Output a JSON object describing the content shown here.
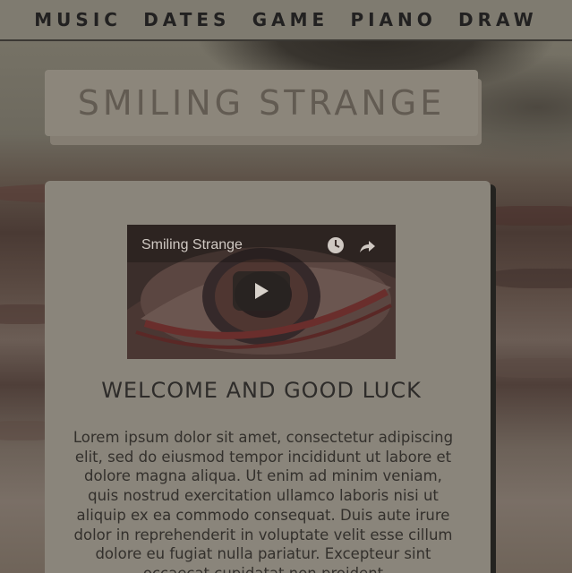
{
  "nav": {
    "items": [
      {
        "label": "MUSIC"
      },
      {
        "label": "DATES"
      },
      {
        "label": "GAME"
      },
      {
        "label": "PIANO"
      },
      {
        "label": "DRAW"
      }
    ]
  },
  "header": {
    "title": "SMILING STRANGE"
  },
  "video": {
    "title": "Smiling Strange",
    "icons": [
      "clock-icon",
      "share-icon",
      "play-icon"
    ]
  },
  "main": {
    "heading": "WELCOME AND GOOD LUCK",
    "body": "Lorem ipsum dolor sit amet, consectetur adipiscing elit, sed do eiusmod tempor incididunt ut labore et dolore magna aliqua. Ut enim ad minim veniam, quis nostrud exercitation ullamco laboris nisi ut aliquip ex ea commodo consequat. Duis aute irure dolor in reprehenderit in voluptate velit esse cillum dolore eu fugiat nulla pariatur. Excepteur sint occaecat cupidatat non proident"
  },
  "colors": {
    "nav_bg": "#7f7b70",
    "card_bg": "#8a857b",
    "title_text": "#625b52",
    "text_dark": "#2e2c2a"
  }
}
